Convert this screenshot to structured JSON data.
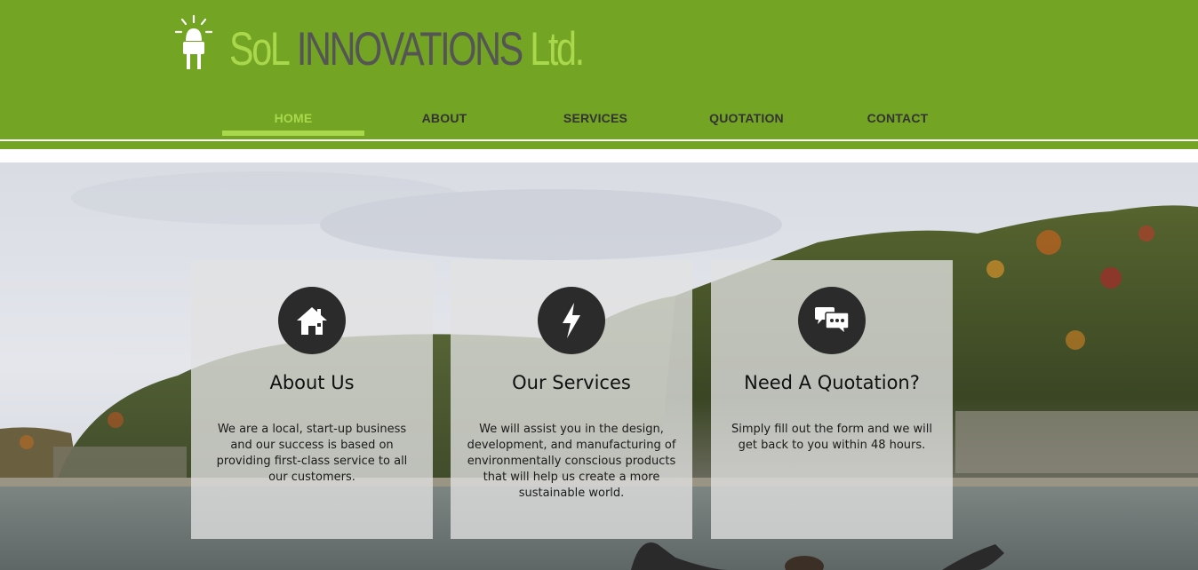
{
  "brand": {
    "name_prefix": "SoL",
    "name_main": "INNOVATIONS",
    "name_suffix": "Ltd.",
    "logo_icon": "plug-bulb-icon",
    "colors": {
      "header": "#73a423",
      "accent": "#a9d84c",
      "dark_text": "#555555"
    }
  },
  "nav": {
    "items": [
      {
        "label": "HOME",
        "active": true
      },
      {
        "label": "ABOUT",
        "active": false
      },
      {
        "label": "SERVICES",
        "active": false
      },
      {
        "label": "QUOTATION",
        "active": false
      },
      {
        "label": "CONTACT",
        "active": false
      }
    ]
  },
  "cards": [
    {
      "icon": "home-icon",
      "title": "About Us",
      "text": "We are a local, start-up business and our success is based on providing first-class service to all our customers."
    },
    {
      "icon": "lightning-icon",
      "title": "Our Services",
      "text": "We will assist you in the design, development, and manufacturing of environmentally conscious products that will help us create a more sustainable world."
    },
    {
      "icon": "chat-icon",
      "title": "Need A Quotation?",
      "text": "Simply fill out the form and we will get back to you within 48 hours."
    }
  ]
}
